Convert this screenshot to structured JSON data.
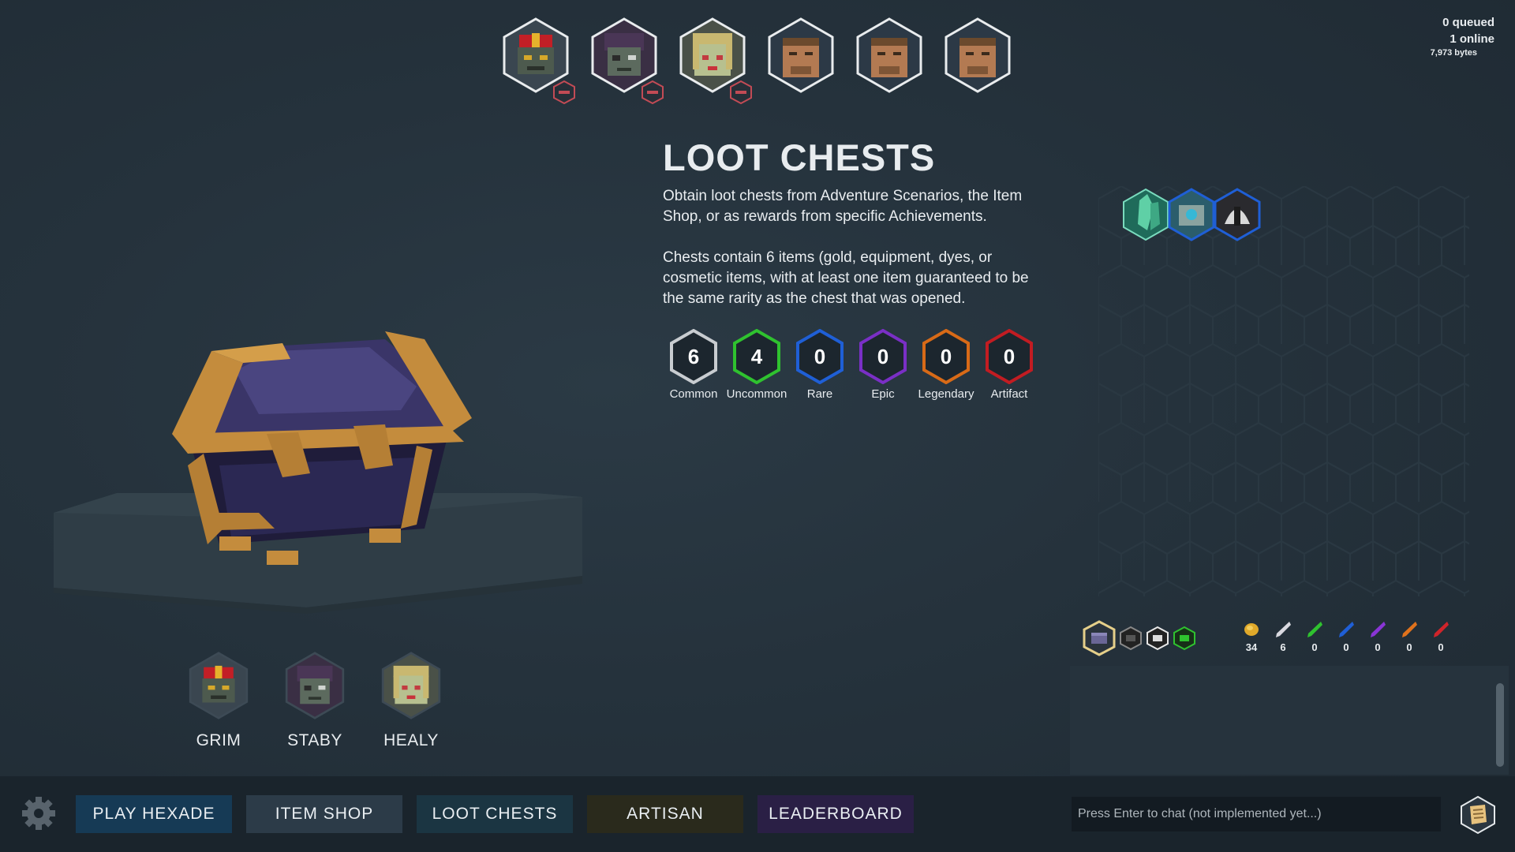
{
  "party": [
    {
      "name": "grim",
      "removable": true
    },
    {
      "name": "staby",
      "removable": true
    },
    {
      "name": "healy",
      "removable": true
    },
    {
      "name": "empty",
      "removable": false
    },
    {
      "name": "empty",
      "removable": false
    },
    {
      "name": "empty",
      "removable": false
    }
  ],
  "status": {
    "queued": "0 queued",
    "online": "1 online",
    "bytes": "7,973 bytes"
  },
  "page": {
    "title": "LOOT CHESTS",
    "desc1": "Obtain loot chests from Adventure Scenarios, the Item Shop, or as rewards from specific Achievements.",
    "desc2": "Chests contain 6 items (gold, equipment, dyes, or cosmetic items, with at least one item guaranteed to be the same rarity as the chest that was opened."
  },
  "rarities": [
    {
      "label": "Common",
      "count": "6",
      "color": "#c8ccd0"
    },
    {
      "label": "Uncommon",
      "count": "4",
      "color": "#2fc22f"
    },
    {
      "label": "Rare",
      "count": "0",
      "color": "#1f5fd6"
    },
    {
      "label": "Epic",
      "count": "0",
      "color": "#7a2fc6"
    },
    {
      "label": "Legendary",
      "count": "0",
      "color": "#d86a17"
    },
    {
      "label": "Artifact",
      "count": "0",
      "color": "#c21c22"
    }
  ],
  "heroes": [
    {
      "name": "GRIM"
    },
    {
      "name": "STABY"
    },
    {
      "name": "HEALY"
    }
  ],
  "resources": [
    {
      "icon": "gold-coin-icon",
      "value": "34",
      "color": "#e0a92a"
    },
    {
      "icon": "common-dye-icon",
      "value": "6",
      "color": "#d9d9e0"
    },
    {
      "icon": "uncommon-dye-icon",
      "value": "0",
      "color": "#2fc22f"
    },
    {
      "icon": "rare-dye-icon",
      "value": "0",
      "color": "#1f5fd6"
    },
    {
      "icon": "epic-dye-icon",
      "value": "0",
      "color": "#8a35d6"
    },
    {
      "icon": "legendary-dye-icon",
      "value": "0",
      "color": "#e0721c"
    },
    {
      "icon": "artifact-dye-icon",
      "value": "0",
      "color": "#d0242a"
    }
  ],
  "nav": [
    {
      "label": "PLAY HEXADE",
      "bg": "#163a55"
    },
    {
      "label": "ITEM SHOP",
      "bg": "#2c3b48"
    },
    {
      "label": "LOOT CHESTS",
      "bg": "#1b3542"
    },
    {
      "label": "ARTISAN",
      "bg": "#2a2a1c"
    },
    {
      "label": "LEADERBOARD",
      "bg": "#2a1f45"
    }
  ],
  "chat": {
    "placeholder": "Press Enter to chat (not implemented yet...)"
  }
}
